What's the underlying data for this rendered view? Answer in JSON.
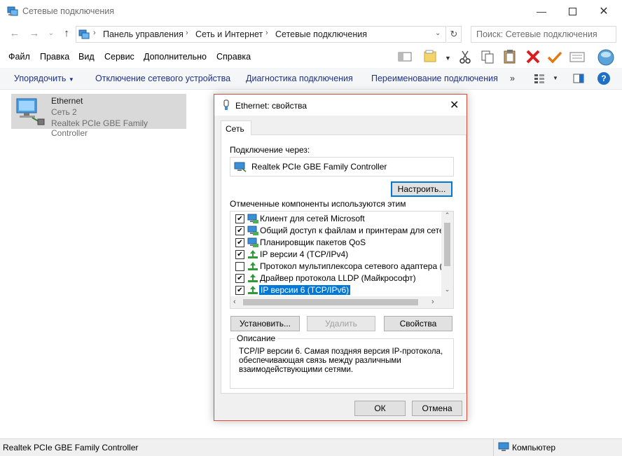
{
  "window": {
    "title": "Сетевые подключения"
  },
  "address": {
    "crumbs": [
      "Панель управления",
      "Сеть и Интернет",
      "Сетевые подключения"
    ],
    "search_placeholder": "Поиск: Сетевые подключения"
  },
  "menu": [
    "Файл",
    "Правка",
    "Вид",
    "Сервис",
    "Дополнительно",
    "Справка"
  ],
  "commands": {
    "organize": "Упорядочить",
    "disable": "Отключение сетевого устройства",
    "diagnose": "Диагностика подключения",
    "rename": "Переименование подключения",
    "more": "»"
  },
  "connection": {
    "name": "Ethernet",
    "network": "Сеть  2",
    "adapter": "Realtek PCIe GBE Family Controller"
  },
  "status": {
    "left": "Realtek PCIe GBE Family Controller",
    "right": "Компьютер"
  },
  "dialog": {
    "title": "Ethernet: свойства",
    "tab": "Сеть",
    "connect_via_label": "Подключение через:",
    "adapter": "Realtek PCIe GBE Family Controller",
    "configure_button": "Настроить...",
    "components_label": "Отмеченные компоненты используются этим подключением:",
    "components": [
      {
        "label": "Клиент для сетей Microsoft",
        "checked": true,
        "icon": "network-client-icon"
      },
      {
        "label": "Общий доступ к файлам и принтерам для сетей Mi",
        "checked": true,
        "icon": "network-service-icon"
      },
      {
        "label": "Планировщик пакетов QoS",
        "checked": true,
        "icon": "network-service-icon"
      },
      {
        "label": "IP версии 4 (TCP/IPv4)",
        "checked": true,
        "icon": "protocol-icon"
      },
      {
        "label": "Протокол мультиплексора сетевого адаптера (Май",
        "checked": false,
        "icon": "protocol-icon"
      },
      {
        "label": "Драйвер протокола LLDP (Майкрософт)",
        "checked": true,
        "icon": "protocol-icon"
      },
      {
        "label": "IP версии 6 (TCP/IPv6)",
        "checked": true,
        "icon": "protocol-icon",
        "selected": true
      }
    ],
    "install_button": "Установить...",
    "remove_button": "Удалить",
    "properties_button": "Свойства",
    "description_legend": "Описание",
    "description_text": "TCP/IP версии 6. Самая поздняя версия IP-протокола, обеспечивающая связь между различными взаимодействующими сетями.",
    "description_lines": [
      "TCP/IP версии 6. Самая поздняя версия IP-протокола,",
      "обеспечивающая связь между различными",
      "взаимодействующими сетями."
    ],
    "ok_button": "ОК",
    "cancel_button": "Отмена"
  },
  "colors": {
    "accent": "#0078d7",
    "dialog_border": "#e04a3a",
    "selection": "#0078d7"
  }
}
